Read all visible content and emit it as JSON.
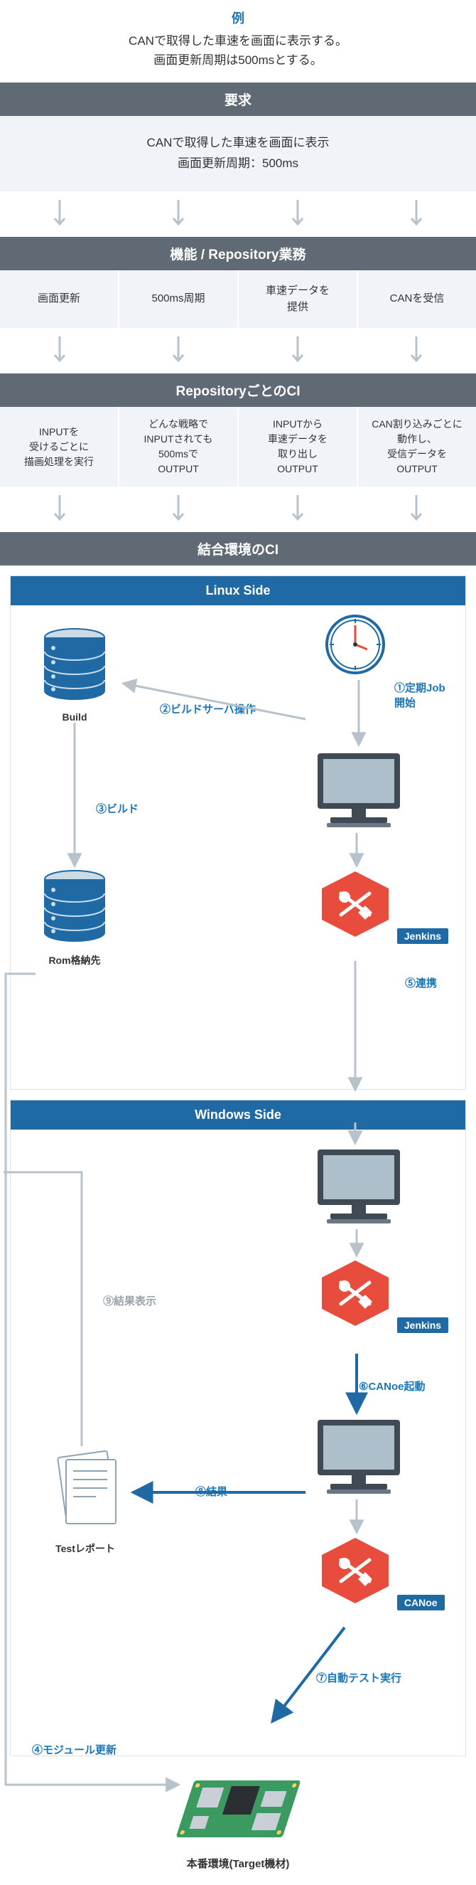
{
  "example": {
    "label": "例",
    "desc1": "CANで取得した車速を画面に表示する。",
    "desc2": "画面更新周期は500msとする。"
  },
  "bars": {
    "req": "要求",
    "func": "機能 / Repository業務",
    "ci_repo": "RepositoryごとのCI",
    "ci_int": "結合環境のCI"
  },
  "req_box": {
    "l1": "CANで取得した車速を画面に表示",
    "l2": "画面更新周期：500ms"
  },
  "func_cells": [
    "画面更新",
    "500ms周期",
    "車速データを\n提供",
    "CANを受信"
  ],
  "ci_cells": [
    "INPUTを\n受けるごとに\n描画処理を実行",
    "どんな戦略で\nINPUTされても\n500msで\nOUTPUT",
    "INPUTから\n車速データを\n取り出し\nOUTPUT",
    "CAN割り込みごとに\n動作し、\n受信データを\nOUTPUT"
  ],
  "panels": {
    "linux": "Linux Side",
    "windows": "Windows Side"
  },
  "linux": {
    "build": "Build",
    "rom": "Rom格納先",
    "jenkins": "Jenkins",
    "s1": "①定期Job\n開始",
    "s2": "②ビルドサーバ操作",
    "s3": "③ビルド",
    "s5": "⑤連携"
  },
  "windows": {
    "jenkins": "Jenkins",
    "canoe": "CANoe",
    "testreport": "Testレポート",
    "s6": "⑥CANoe起動",
    "s7": "⑦自動テスト実行",
    "s8": "⑧結果",
    "s9": "⑨結果表示"
  },
  "s4": "④モジュール更新",
  "target": "本番環境(Target機材)"
}
